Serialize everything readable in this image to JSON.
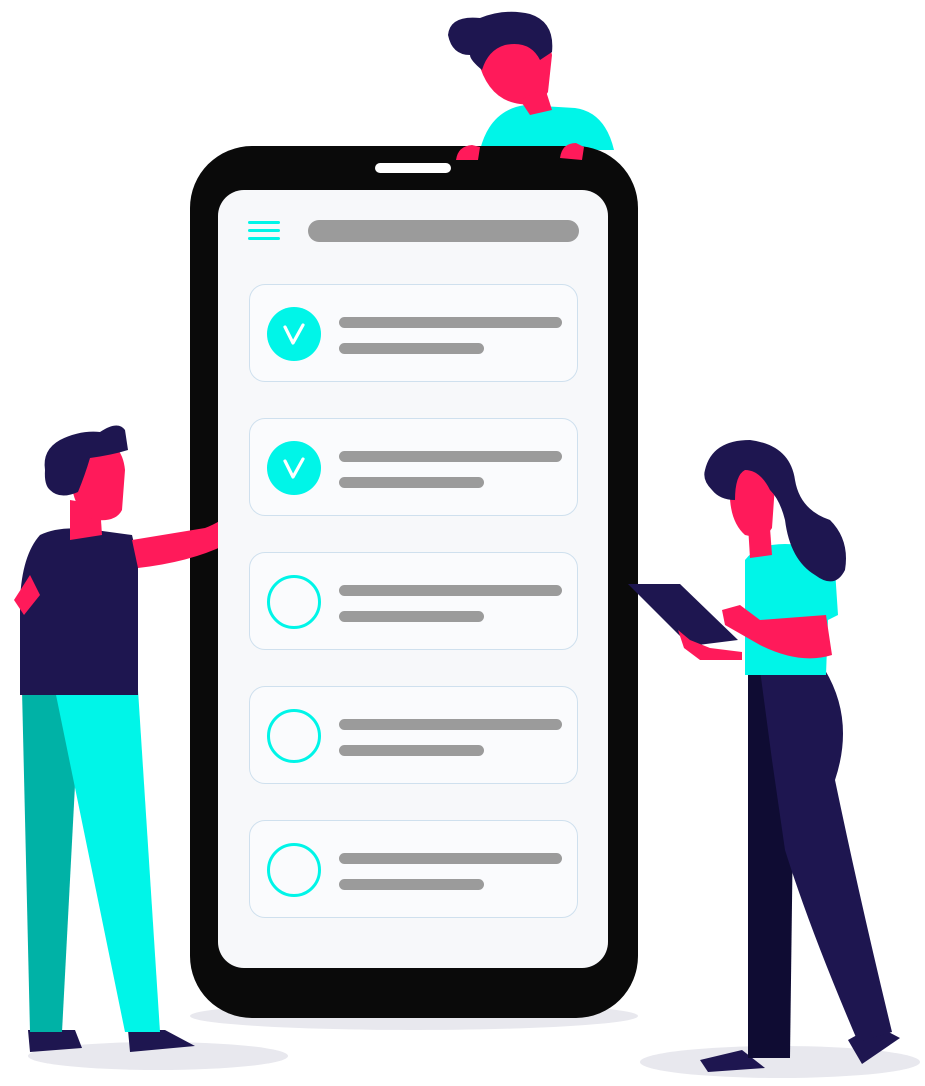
{
  "colors": {
    "accent": "#00f5e8",
    "bar": "#9b9b9b",
    "border": "#cfe0ee",
    "device": "#0a0a0a",
    "navy": "#1e1650",
    "skin": "#ff1a5a",
    "teal_dark": "#00b2a6",
    "shadow": "#e8e8ee"
  },
  "icons": {
    "menu": "hamburger-icon",
    "checked": "checkmark-icon",
    "unchecked": "empty-circle-icon"
  },
  "tasks": [
    {
      "state": "checked"
    },
    {
      "state": "checked"
    },
    {
      "state": "unchecked"
    },
    {
      "state": "unchecked"
    },
    {
      "state": "unchecked"
    }
  ],
  "figures": [
    "man-pointing",
    "man-peeking-over-phone",
    "woman-with-tablet"
  ]
}
